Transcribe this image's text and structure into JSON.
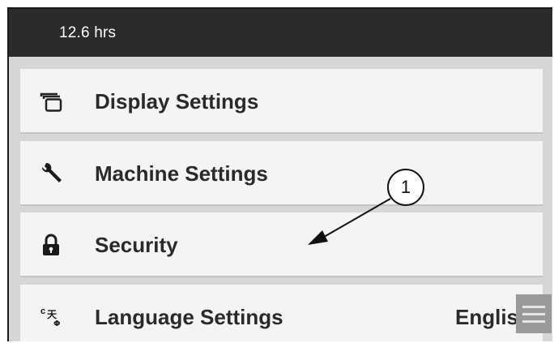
{
  "status_bar": {
    "hours": "12.6 hrs"
  },
  "menu": {
    "items": [
      {
        "label": "Display Settings",
        "icon": "display-icon"
      },
      {
        "label": "Machine Settings",
        "icon": "wrench-icon"
      },
      {
        "label": "Security",
        "icon": "lock-icon"
      },
      {
        "label": "Language Settings",
        "icon": "language-icon",
        "value": "Englis"
      }
    ]
  },
  "annotation": {
    "callout_number": "1"
  },
  "menu_button": {
    "icon": "hamburger-menu-icon"
  }
}
